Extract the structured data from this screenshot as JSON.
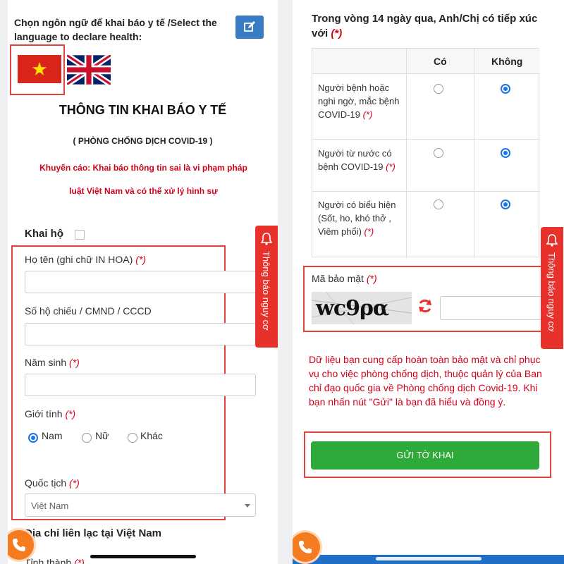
{
  "left": {
    "language_prompt": "Chọn ngôn ngữ để khai báo y tế /Select the language to declare health:",
    "title": "THÔNG TIN KHAI BÁO Y TẾ",
    "subtitle": "( PHÒNG CHỐNG DỊCH COVID-19 )",
    "warning_line1": "Khuyến cáo: Khai báo thông tin sai là vi phạm pháp",
    "warning_line2": "luật Việt Nam và có thể xử lý hình sự",
    "on_behalf_label": "Khai hộ",
    "required_mark": "(*)",
    "fields": {
      "full_name": "Họ tên (ghi chữ IN HOA)",
      "id_number": "Số hộ chiếu / CMND / CCCD",
      "birth_year": "Năm sinh",
      "gender": "Giới tính",
      "nationality": "Quốc tịch"
    },
    "gender_options": [
      "Nam",
      "Nữ",
      "Khác"
    ],
    "gender_selected": "Nam",
    "nationality_value": "Việt Nam",
    "address_section": "Địa chỉ liên lạc tại Việt Nam",
    "province_label": "Tỉnh thành"
  },
  "side_tab": {
    "label": "Thông báo nguy cơ"
  },
  "right": {
    "exposure_question": "Trong vòng 14 ngày qua, Anh/Chị có tiếp xúc với",
    "columns": [
      "Có",
      "Không"
    ],
    "rows": [
      {
        "text": "Người bệnh hoặc nghi ngờ, mắc bệnh COVID-19",
        "answer": "Không"
      },
      {
        "text": "Người từ nước có bệnh COVID-19",
        "answer": "Không"
      },
      {
        "text": "Người có biểu hiện (Sốt, ho, khó thở , Viêm phổi)",
        "answer": "Không"
      }
    ],
    "captcha_label": "Mã bảo mật",
    "captcha_text": "wc9ρα",
    "notice": "Dữ liệu bạn cung cấp hoàn toàn bảo mật và chỉ phục vụ cho việc phòng chống dịch, thuộc quản lý của Ban chỉ đạo quốc gia về Phòng chống dịch Covid-19. Khi bạn nhấn nút \"Gửi\" là bạn đã hiểu và đồng ý.",
    "submit_label": "GỬI TỜ KHAI"
  },
  "colors": {
    "brand_red": "#e8312b",
    "required_red": "#d0021b",
    "edit_button_blue": "#3a7cc4",
    "submit_green": "#2eaa3a",
    "call_orange": "#f47b20",
    "highlight_box": "#e0443e"
  },
  "icons": {
    "edit": "edit-icon",
    "flag_vn": "vietnam-flag-icon",
    "flag_uk": "uk-flag-icon",
    "bell": "bell-icon",
    "refresh": "refresh-icon",
    "phone": "phone-icon"
  }
}
